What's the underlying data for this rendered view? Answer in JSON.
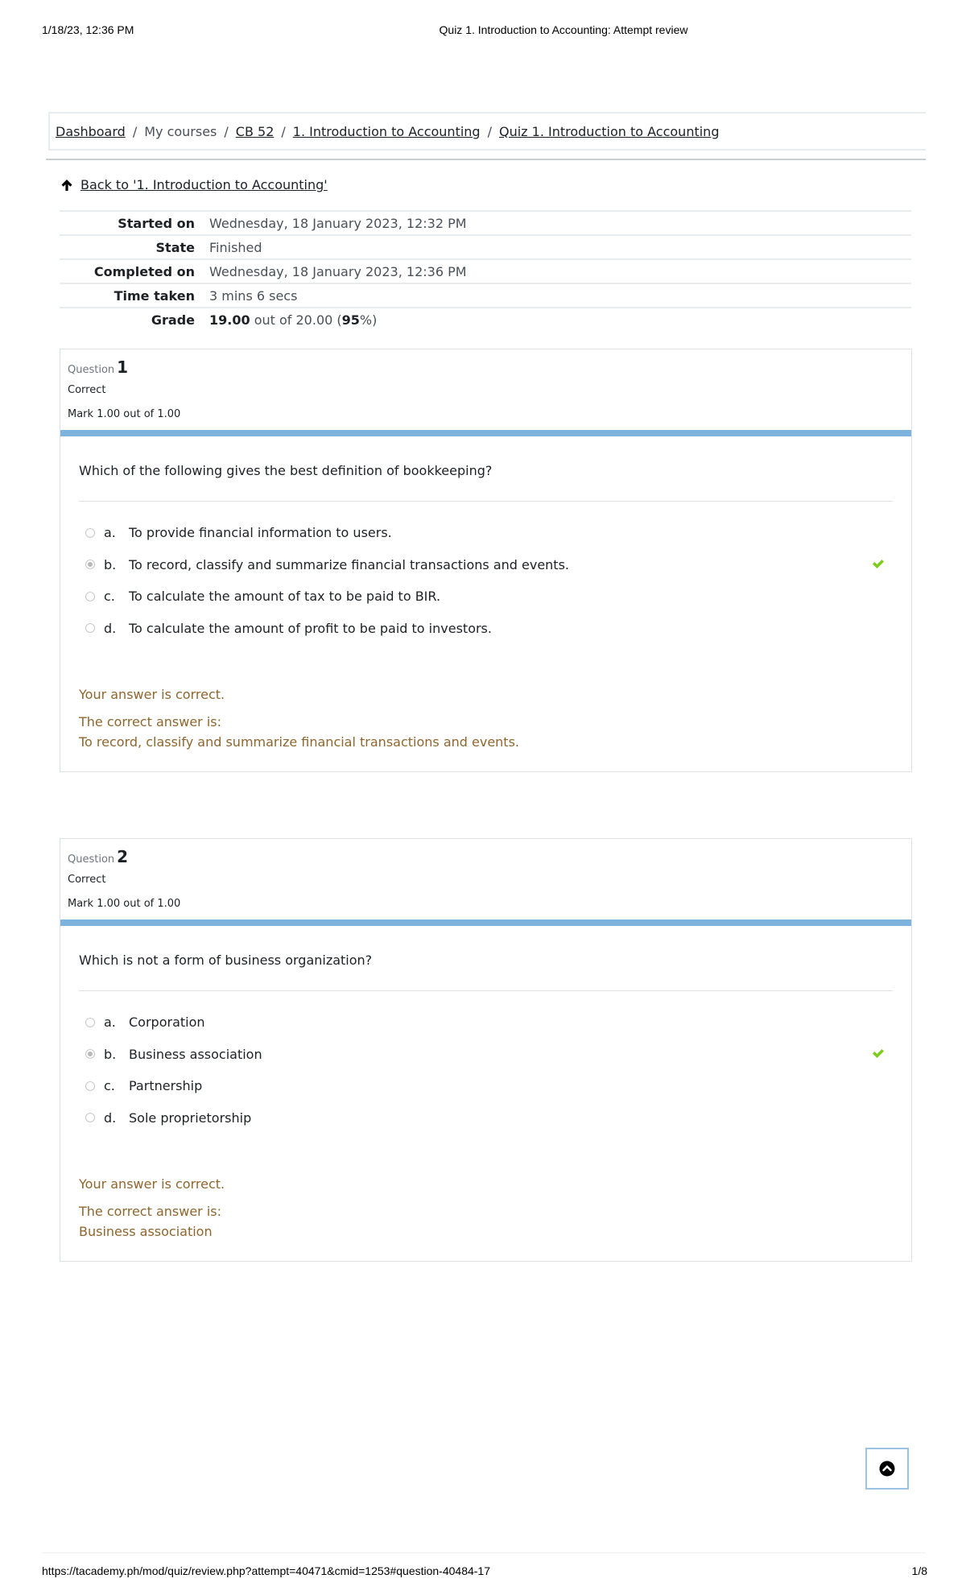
{
  "print_header": {
    "datetime": "1/18/23, 12:36 PM",
    "title": "Quiz 1. Introduction to Accounting: Attempt review"
  },
  "print_footer": {
    "url": "https://tacademy.ph/mod/quiz/review.php?attempt=40471&cmid=1253#question-40484-17",
    "page": "1/8"
  },
  "breadcrumb": {
    "items": [
      {
        "label": "Dashboard",
        "link": true
      },
      {
        "label": "My courses",
        "link": false
      },
      {
        "label": "CB 52",
        "link": true
      },
      {
        "label": "1. Introduction to Accounting",
        "link": true
      },
      {
        "label": "Quiz 1. Introduction to Accounting",
        "link": true
      }
    ],
    "separator": "/"
  },
  "back_link": {
    "icon": "arrow-up-icon",
    "label": "Back to '1. Introduction to Accounting'"
  },
  "summary": {
    "rows": [
      {
        "key": "Started on",
        "value": "Wednesday, 18 January 2023, 12:32 PM"
      },
      {
        "key": "State",
        "value": "Finished"
      },
      {
        "key": "Completed on",
        "value": "Wednesday, 18 January 2023, 12:36 PM"
      },
      {
        "key": "Time taken",
        "value": "3 mins 6 secs"
      }
    ],
    "grade": {
      "key": "Grade",
      "score": "19.00",
      "middle": " out of 20.00 (",
      "percent": "95",
      "suffix": "%)"
    }
  },
  "questions": [
    {
      "label": "Question",
      "number": "1",
      "state": "Correct",
      "mark": "Mark 1.00 out of 1.00",
      "text": "Which of the following gives the best definition of bookkeeping?",
      "answers": [
        {
          "letter": "a.",
          "text": "To provide financial information to users.",
          "selected": false
        },
        {
          "letter": "b.",
          "text": "To record, classify and summarize financial transactions and events.",
          "selected": true
        },
        {
          "letter": "c.",
          "text": "To calculate the amount of tax to be paid to BIR.",
          "selected": false
        },
        {
          "letter": "d.",
          "text": "To calculate the amount of profit to be paid to investors.",
          "selected": false
        }
      ],
      "feedback": "Your answer is correct.",
      "correct_label": "The correct answer is:",
      "correct_answer": "To record, classify and summarize financial transactions and events."
    },
    {
      "label": "Question",
      "number": "2",
      "state": "Correct",
      "mark": "Mark 1.00 out of 1.00",
      "text": "Which is not a form of business organization?",
      "answers": [
        {
          "letter": "a.",
          "text": "Corporation",
          "selected": false
        },
        {
          "letter": "b.",
          "text": "Business association",
          "selected": true
        },
        {
          "letter": "c.",
          "text": "Partnership",
          "selected": false
        },
        {
          "letter": "d.",
          "text": "Sole proprietorship",
          "selected": false
        }
      ],
      "feedback": "Your answer is correct.",
      "correct_label": "The correct answer is:",
      "correct_answer": "Business association"
    }
  ],
  "colors": {
    "bar": "#7eb3dd",
    "check": "#7ccc19",
    "feedback": "#8e662e"
  },
  "back_to_top": {
    "icon": "chevron-up-circle-icon"
  }
}
